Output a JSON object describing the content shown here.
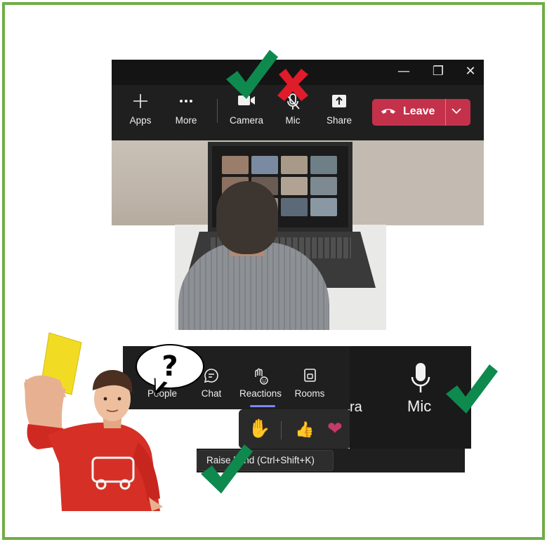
{
  "window_controls": {
    "minimize": "—",
    "restore": "❐",
    "close": "✕"
  },
  "top_toolbar": {
    "apps": {
      "label": "Apps",
      "icon": "plus-icon"
    },
    "more": {
      "label": "More",
      "icon": "ellipsis-icon"
    },
    "camera": {
      "label": "Camera",
      "icon": "video-camera-icon"
    },
    "mic": {
      "label": "Mic",
      "icon": "mic-off-icon"
    },
    "share": {
      "label": "Share",
      "icon": "share-upload-icon"
    },
    "leave": {
      "label": "Leave",
      "icon": "phone-hangup-icon",
      "dropdown": "chevron-down-icon"
    }
  },
  "bottom_toolbar": {
    "people": {
      "label": "People",
      "icon": "people-icon"
    },
    "chat": {
      "label": "Chat",
      "icon": "chat-bubble-icon"
    },
    "reactions": {
      "label": "Reactions",
      "icon": "hand-smile-icon"
    },
    "rooms": {
      "label": "Rooms",
      "icon": "rooms-icon"
    }
  },
  "reactions_popup": {
    "raise_hand": "✋",
    "like": "👍",
    "heart": "❤"
  },
  "tooltip": {
    "text": "Raise hand (Ctrl+Shift+K)"
  },
  "mic_panel": {
    "label": "Mic",
    "partial_label": "ra"
  },
  "speech_bubble": {
    "text": "?"
  },
  "colors": {
    "frame_border": "#70ad47",
    "leave_red": "#c4314b",
    "check_green": "#0e8a4f",
    "cross_red": "#e01b2a",
    "toolbar_bg": "#1f1f1f"
  }
}
